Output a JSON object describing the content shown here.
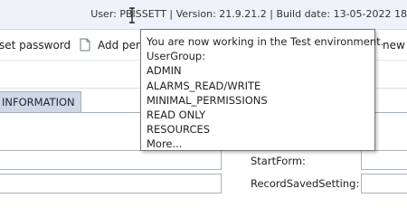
{
  "header": {
    "user_info": "User: PBISSETT | Version: 21.9.21.2 | Build date: 13-05-2022 18"
  },
  "toolbar": {
    "reset_password_label": "set password",
    "add_label": "Add per",
    "new_label": "new"
  },
  "tabs": {
    "information_label": "INFORMATION"
  },
  "form": {
    "start_form_label": "StartForm:",
    "record_saved_setting_label": "RecordSavedSetting:"
  },
  "tooltip": {
    "environment_message": "You are now working in the Test environment.",
    "usergroup_heading": "UserGroup:",
    "groups": [
      "ADMIN",
      "ALARMS_READ/WRITE",
      "MINIMAL_PERMISSIONS",
      "READ ONLY",
      "RESOURCES"
    ],
    "more": "More..."
  }
}
